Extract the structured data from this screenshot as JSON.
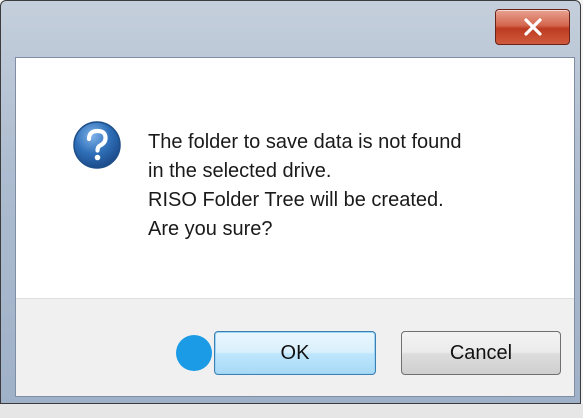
{
  "dialog": {
    "message_lines": [
      "The folder to save data is not found",
      "in the selected drive.",
      "RISO Folder Tree will be created.",
      "Are you sure?"
    ],
    "buttons": {
      "ok_label": "OK",
      "cancel_label": "Cancel"
    },
    "icons": {
      "close": "close-icon",
      "message": "question-icon"
    }
  },
  "colors": {
    "close_button": "#c9472c",
    "ok_button_border": "#3c7fb1",
    "question_icon": "#2f6fb8",
    "marker": "#1b9be6"
  }
}
